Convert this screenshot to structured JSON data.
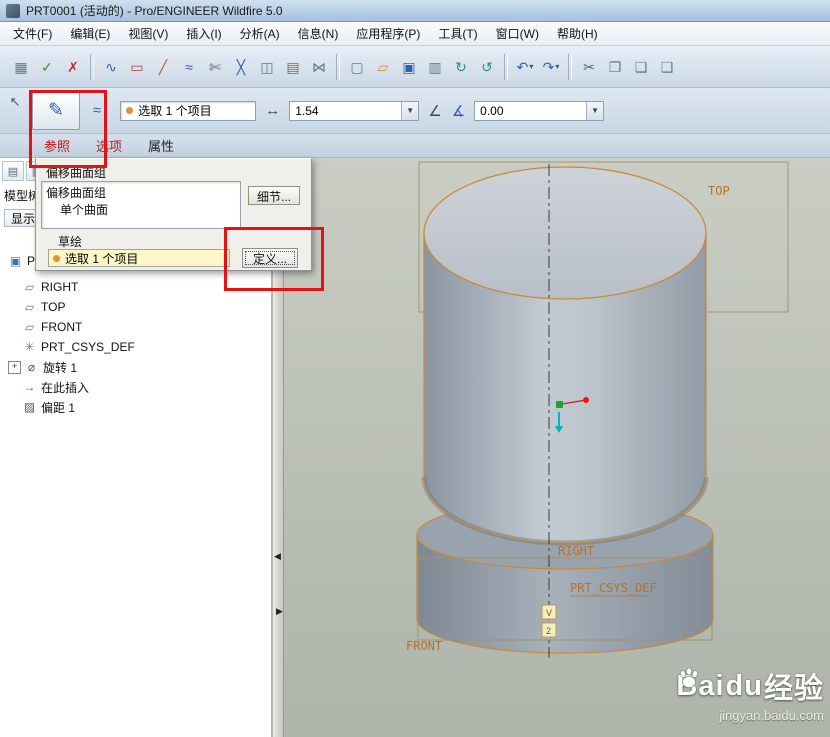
{
  "window": {
    "title": "PRT0001 (活动的) - Pro/ENGINEER Wildfire 5.0"
  },
  "menu": {
    "items": [
      "文件(F)",
      "编辑(E)",
      "视图(V)",
      "插入(I)",
      "分析(A)",
      "信息(N)",
      "应用程序(P)",
      "工具(T)",
      "窗口(W)",
      "帮助(H)"
    ]
  },
  "toolbar": {
    "items": [
      {
        "name": "datum-display-icon",
        "glyph": "▦",
        "color": "#5f7890"
      },
      {
        "name": "select-verify-icon",
        "glyph": "✓",
        "color": "#2e8b2e"
      },
      {
        "name": "delete-icon",
        "glyph": "✗",
        "color": "#c03030"
      },
      {
        "type": "sep"
      },
      {
        "name": "spline-icon",
        "glyph": "∿",
        "color": "#3060b0"
      },
      {
        "name": "rectangle-icon",
        "glyph": "▭",
        "color": "#b04040"
      },
      {
        "name": "line-icon",
        "glyph": "╱",
        "color": "#c05050"
      },
      {
        "name": "curve-icon",
        "glyph": "≈",
        "color": "#3060b0"
      },
      {
        "name": "trim-icon",
        "glyph": "✄",
        "color": "#556070"
      },
      {
        "name": "divide-icon",
        "glyph": "╳",
        "color": "#3060b0"
      },
      {
        "name": "mirror-icon",
        "glyph": "◫",
        "color": "#5f7890"
      },
      {
        "name": "pattern-icon",
        "glyph": "▤",
        "color": "#8a6a30"
      },
      {
        "name": "merge-icon",
        "glyph": "⋈",
        "color": "#5f7890"
      },
      {
        "type": "sep"
      },
      {
        "name": "new-file-icon",
        "glyph": "▢",
        "color": "#5f7890"
      },
      {
        "name": "open-file-icon",
        "glyph": "▱",
        "color": "#c09030"
      },
      {
        "name": "save-icon",
        "glyph": "▣",
        "color": "#3060b0"
      },
      {
        "name": "print-icon",
        "glyph": "▥",
        "color": "#5f7890"
      },
      {
        "name": "model-refresh-icon",
        "glyph": "↻",
        "color": "#2a8a8a"
      },
      {
        "name": "update-icon",
        "glyph": "↺",
        "color": "#2a8a8a"
      },
      {
        "type": "sep"
      },
      {
        "name": "undo-icon",
        "glyph": "↶",
        "color": "#3060b0",
        "caret": true
      },
      {
        "name": "redo-icon",
        "glyph": "↷",
        "color": "#3060b0",
        "caret": true
      },
      {
        "type": "sep"
      },
      {
        "name": "cut-icon",
        "glyph": "✂",
        "color": "#556070"
      },
      {
        "name": "copy-icon",
        "glyph": "❐",
        "color": "#5f7890"
      },
      {
        "name": "paste-icon",
        "glyph": "❏",
        "color": "#5f7890"
      },
      {
        "name": "paste-special-icon",
        "glyph": "❑",
        "color": "#5f7890"
      }
    ]
  },
  "dashboard": {
    "select_value": "选取 1 个项目",
    "offset_value": "1.54",
    "angle_value": "0.00",
    "tabs": [
      {
        "label": "参照"
      },
      {
        "label": "选项"
      },
      {
        "label": "属性"
      }
    ]
  },
  "panel": {
    "group_title": "偏移曲面组",
    "surface_item": "单个曲面",
    "details_button": "细节...",
    "sketch_label": "草绘",
    "select_value": "选取 1 个项目",
    "define_button": "定义..."
  },
  "tree": {
    "header": "模型树",
    "show_button": "显示",
    "items": [
      {
        "icon": "part-icon",
        "glyph": "▣",
        "color": "#3a6fb5",
        "label": "PR",
        "root": true
      },
      {
        "icon": "datum-plane-icon",
        "glyph": "▱",
        "color": "#8a7a5a",
        "label": "RIGHT",
        "indent": true
      },
      {
        "icon": "datum-plane-icon",
        "glyph": "▱",
        "color": "#8a7a5a",
        "label": "TOP",
        "indent": true
      },
      {
        "icon": "datum-plane-icon",
        "glyph": "▱",
        "color": "#8a7a5a",
        "label": "FRONT",
        "indent": true
      },
      {
        "icon": "csys-icon",
        "glyph": "✳",
        "color": "#8a7a5a",
        "label": "PRT_CSYS_DEF",
        "indent": true
      },
      {
        "icon": "revolve-icon",
        "glyph": "⌀",
        "color": "#555555",
        "label": "旋转 1",
        "expander": true
      },
      {
        "icon": "insert-here-icon",
        "glyph": "→",
        "color": "#c03030",
        "label": "在此插入",
        "indent": true
      },
      {
        "icon": "offset-icon",
        "glyph": "▨",
        "color": "#555555",
        "label": "偏距 1",
        "indent": true
      }
    ]
  },
  "viewport": {
    "labels": {
      "top": "TOP",
      "right": "RIGHT",
      "csys": "PRT_CSYS_DEF",
      "front": "FRONT"
    },
    "tags": [
      "V",
      "2"
    ],
    "edge_color": "#c8893c",
    "label_color": "#b5722b"
  },
  "watermark": {
    "part1": "Bai",
    "part2": "du",
    "part3": "经验",
    "url": "jingyan.baidu.com"
  }
}
